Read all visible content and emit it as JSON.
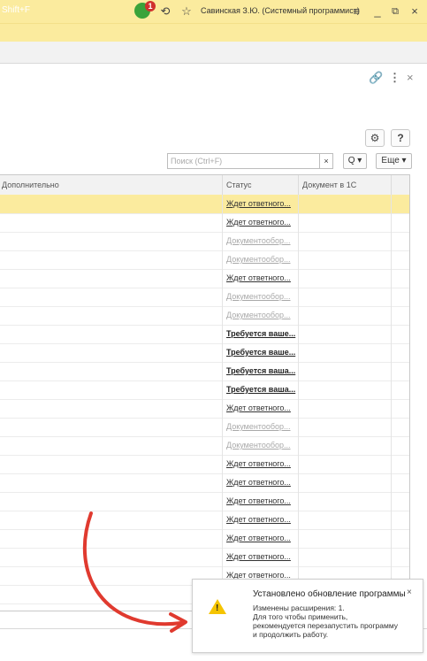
{
  "titlebar": {
    "search_hint": "Shift+F",
    "notification_count": "1",
    "history_icon": "history-icon",
    "favorites_icon": "star-icon",
    "user": "Савинская З.Ю. (Системный программист)",
    "menu_icon": "menu-icon",
    "minimize": "_",
    "restore": "⧉",
    "close": "×"
  },
  "form": {
    "link_icon": "link-icon",
    "more_icon": "⋮",
    "close_icon": "×"
  },
  "toolbar": {
    "settings_icon": "gear-icon",
    "help_label": "?",
    "search_placeholder": "Поиск (Ctrl+F)",
    "clear_label": "×",
    "find_label": "Q ▾",
    "more_label": "Еще ▾"
  },
  "table": {
    "columns": [
      "Дополнительно",
      "Статус",
      "Документ в 1С"
    ],
    "rows": [
      {
        "status": "Ждет ответного...",
        "kind": "waiting",
        "selected": true
      },
      {
        "status": "Ждет ответного...",
        "kind": "waiting"
      },
      {
        "status": "Документообор...",
        "kind": "docflow"
      },
      {
        "status": "Документообор...",
        "kind": "docflow"
      },
      {
        "status": "Ждет ответного...",
        "kind": "waiting"
      },
      {
        "status": "Документообор...",
        "kind": "docflow"
      },
      {
        "status": "Документообор...",
        "kind": "docflow"
      },
      {
        "status": "Требуется ваше...",
        "kind": "required"
      },
      {
        "status": "Требуется ваше...",
        "kind": "required"
      },
      {
        "status": "Требуется ваша...",
        "kind": "required"
      },
      {
        "status": "Требуется ваша...",
        "kind": "required"
      },
      {
        "status": "Ждет ответного...",
        "kind": "waiting"
      },
      {
        "status": "Документообор...",
        "kind": "docflow"
      },
      {
        "status": "Документообор...",
        "kind": "docflow"
      },
      {
        "status": "Ждет ответного...",
        "kind": "waiting"
      },
      {
        "status": "Ждет ответного...",
        "kind": "waiting"
      },
      {
        "status": "Ждет ответного...",
        "kind": "waiting"
      },
      {
        "status": "Ждет ответного...",
        "kind": "waiting"
      },
      {
        "status": "Ждет ответного...",
        "kind": "waiting"
      },
      {
        "status": "Ждет ответного...",
        "kind": "waiting"
      },
      {
        "status": "Ждет ответного...",
        "kind": "waiting"
      },
      {
        "status": "",
        "kind": "waiting"
      }
    ]
  },
  "notification": {
    "title": "Установлено обновление программы",
    "lines": [
      "Изменены расширения: 1.",
      "Для того чтобы применить,",
      "рекомендуется перезапустить программу",
      "и продолжить работу."
    ],
    "close_label": "×",
    "icon": "warning-icon"
  },
  "colors": {
    "accent_yellow": "#fbeb9e",
    "annotation_arrow": "#e03a2f",
    "warning": "#f5c400"
  }
}
